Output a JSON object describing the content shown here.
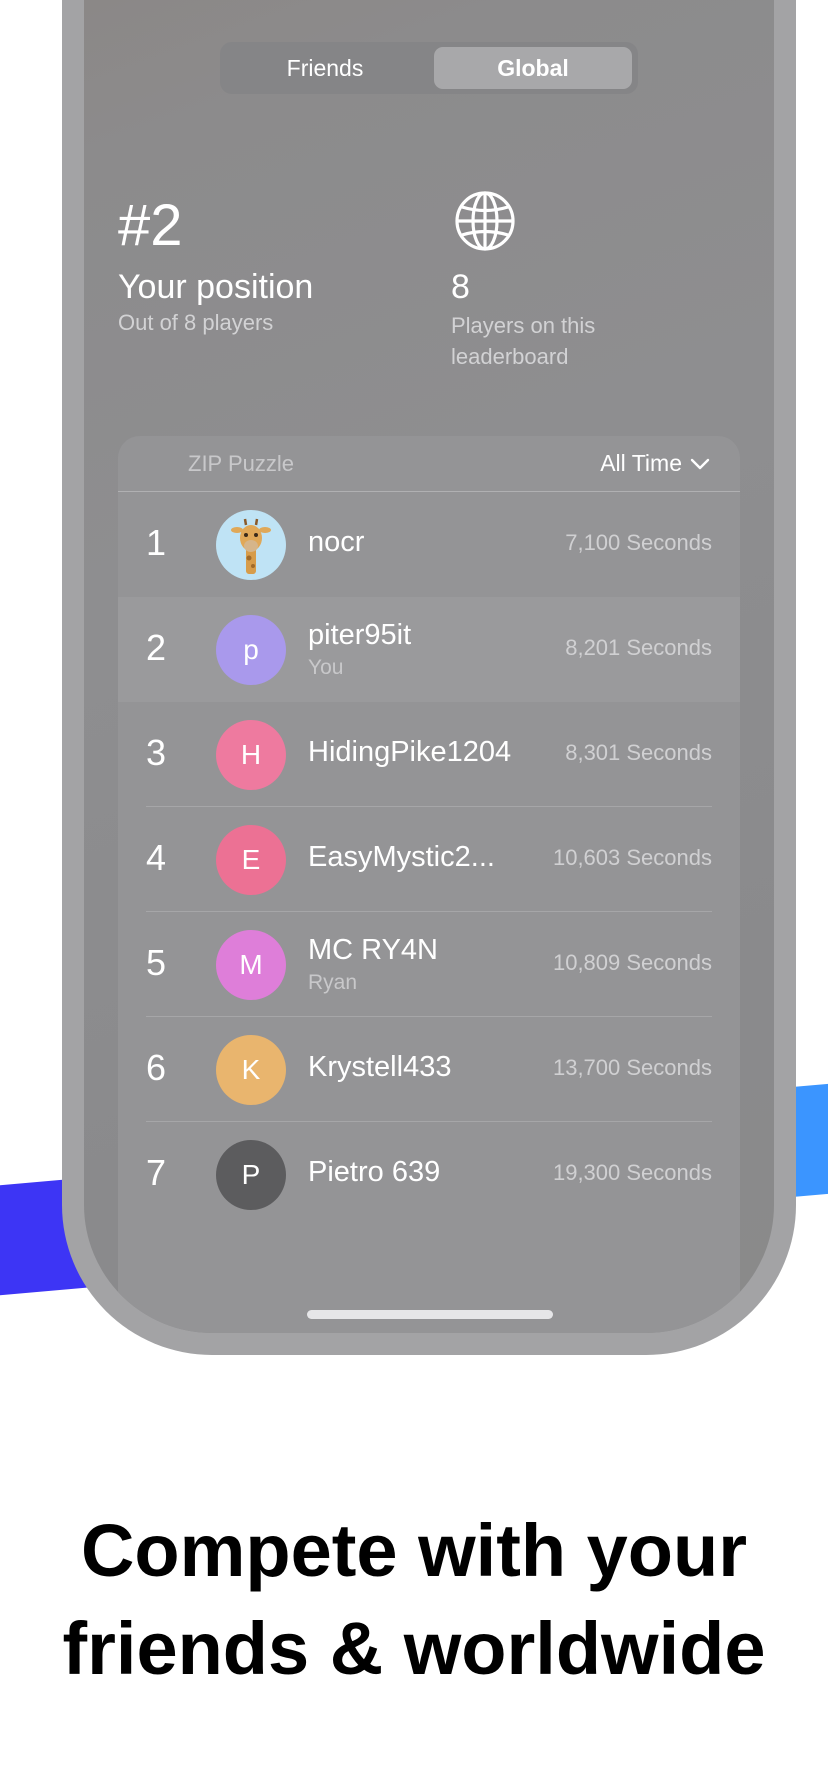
{
  "tabs": [
    {
      "label": "Friends",
      "selected": false
    },
    {
      "label": "Global",
      "selected": true
    }
  ],
  "stats": {
    "rank": "#2",
    "rank_title": "Your position",
    "rank_sub": "Out of 8 players",
    "globe_icon": "globe-icon",
    "player_count": "8",
    "player_count_sub": "Players on this leaderboard"
  },
  "leaderboard": {
    "name": "ZIP Puzzle",
    "filter": "All Time",
    "rows": [
      {
        "rank": "1",
        "initial": "",
        "avatar": "giraffe-avatar",
        "name": "nocr",
        "sub": "",
        "score": "7,100 Seconds",
        "color": "#bfe3f5"
      },
      {
        "rank": "2",
        "initial": "p",
        "name": "piter95it",
        "sub": "You",
        "score": "8,201 Seconds",
        "color": "#a999ec"
      },
      {
        "rank": "3",
        "initial": "H",
        "name": "HidingPike1204",
        "sub": "",
        "score": "8,301 Seconds",
        "color": "#ee7a9f"
      },
      {
        "rank": "4",
        "initial": "E",
        "name": "EasyMystic2...",
        "sub": "",
        "score": "10,603 Seconds",
        "color": "#ec7194"
      },
      {
        "rank": "5",
        "initial": "M",
        "name": "MC RY4N",
        "sub": "Ryan",
        "score": "10,809 Seconds",
        "color": "#de7ed9"
      },
      {
        "rank": "6",
        "initial": "K",
        "name": "Krystell433",
        "sub": "",
        "score": "13,700 Seconds",
        "color": "#e9b56e"
      },
      {
        "rank": "7",
        "initial": "P",
        "name": "Pietro 639",
        "sub": "",
        "score": "19,300 Seconds",
        "color": "#5c5c5e"
      }
    ]
  },
  "caption": {
    "line1": "Compete with your",
    "line2": "friends & worldwide"
  },
  "colors": {
    "band_left": "#3d35f5",
    "band_right": "#3b95ff"
  }
}
